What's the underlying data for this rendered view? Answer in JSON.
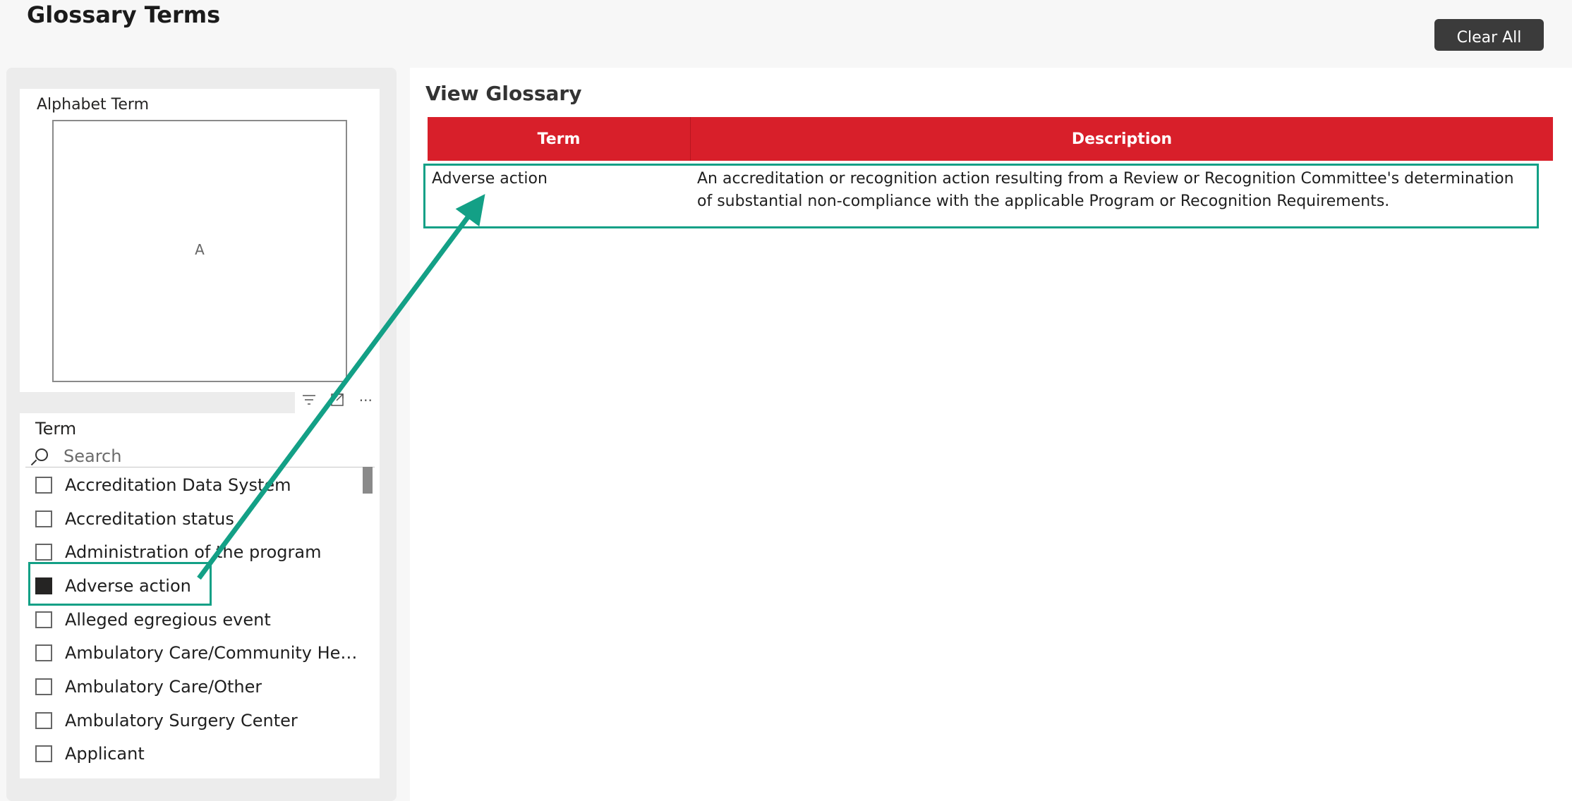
{
  "header": {
    "title": "Glossary Terms",
    "clear_all_label": "Clear All"
  },
  "alphabet_slicer": {
    "title": "Alphabet Term",
    "selected_letter": "A"
  },
  "visual_toolbar": {
    "icons": [
      "filter-icon",
      "focus-mode-icon",
      "more-options-icon"
    ],
    "more_label": "···"
  },
  "term_slicer": {
    "title": "Term",
    "search_placeholder": "Search",
    "items": [
      {
        "label": "Accreditation Data System",
        "checked": false
      },
      {
        "label": "Accreditation status",
        "checked": false
      },
      {
        "label": "Administration of the program",
        "checked": false
      },
      {
        "label": "Adverse action",
        "checked": true
      },
      {
        "label": "Alleged egregious event",
        "checked": false
      },
      {
        "label": "Ambulatory Care/Community Health...",
        "checked": false
      },
      {
        "label": "Ambulatory Care/Other",
        "checked": false
      },
      {
        "label": "Ambulatory Surgery Center",
        "checked": false
      },
      {
        "label": "Applicant",
        "checked": false
      }
    ]
  },
  "glossary": {
    "title": "View Glossary",
    "columns": [
      "Term",
      "Description"
    ],
    "rows": [
      {
        "term": "Adverse action",
        "description": "An accreditation or recognition action resulting from a Review or Recognition Committee's determination of substantial non-compliance with the applicable Program or Recognition Requirements."
      }
    ],
    "header_color": "#d81f2a"
  },
  "annotation": {
    "color": "#13a086"
  }
}
